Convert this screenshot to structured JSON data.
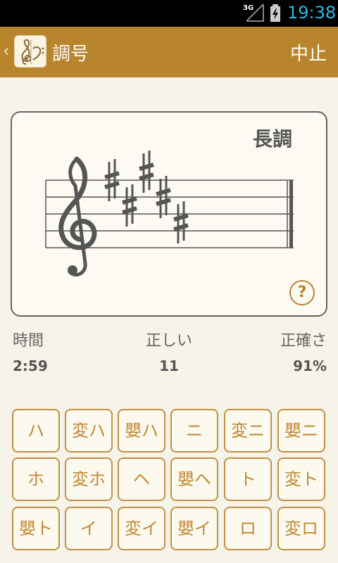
{
  "status_bar": {
    "network": "3G",
    "time": "19:38"
  },
  "action_bar": {
    "back_icon": "chevron-left-icon",
    "app_icon": "clef-icon",
    "title": "調号",
    "abort_label": "中止"
  },
  "card": {
    "mode": "長調",
    "clef": "treble-clef",
    "key_signature": [
      "sharp",
      "sharp",
      "sharp",
      "sharp",
      "sharp"
    ],
    "help_label": "?"
  },
  "stats": {
    "time_label": "時間",
    "time_value": "2:59",
    "correct_label": "正しい",
    "correct_value": "11",
    "accuracy_label": "正確さ",
    "accuracy_value": "91%"
  },
  "keys": [
    [
      "ハ",
      "変ハ",
      "嬰ハ",
      "ニ",
      "変ニ",
      "嬰ニ"
    ],
    [
      "ホ",
      "変ホ",
      "ヘ",
      "嬰ヘ",
      "ト",
      "変ト"
    ],
    [
      "嬰ト",
      "イ",
      "変イ",
      "嬰イ",
      "ロ",
      "変ロ"
    ]
  ],
  "colors": {
    "accent": "#b8852c",
    "background": "#f6f3e8",
    "key_text": "#c08a36"
  }
}
